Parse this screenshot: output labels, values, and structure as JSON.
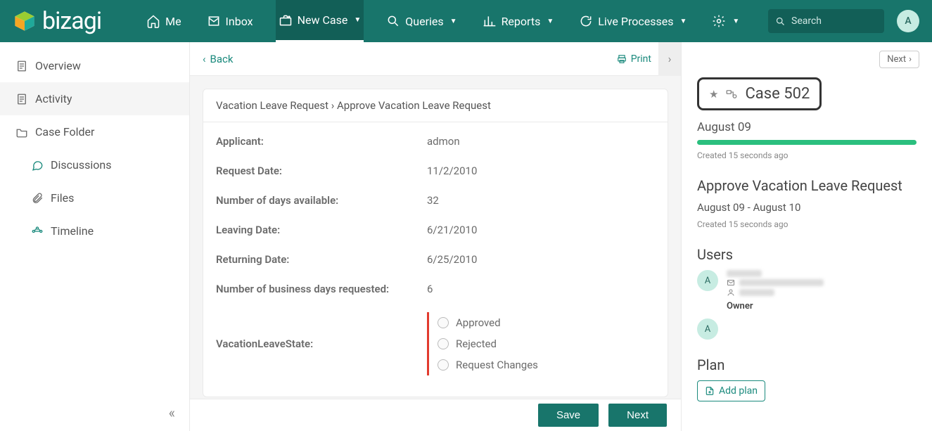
{
  "nav": {
    "brand": "bizagi",
    "items": [
      {
        "icon": "home",
        "label": "Me"
      },
      {
        "icon": "inbox",
        "label": "Inbox"
      },
      {
        "icon": "newcase",
        "label": "New Case",
        "dropdown": true,
        "active": true
      },
      {
        "icon": "search",
        "label": "Queries",
        "dropdown": true
      },
      {
        "icon": "chart",
        "label": "Reports",
        "dropdown": true
      },
      {
        "icon": "refresh",
        "label": "Live Processes",
        "dropdown": true
      },
      {
        "icon": "gear",
        "label": "",
        "dropdown": true
      }
    ],
    "search_placeholder": "Search",
    "avatar_initial": "A"
  },
  "sidebar": {
    "items": [
      {
        "icon": "doc",
        "label": "Overview"
      },
      {
        "icon": "doc",
        "label": "Activity",
        "active": true
      },
      {
        "icon": "folder",
        "label": "Case Folder"
      },
      {
        "icon": "chat",
        "label": "Discussions",
        "sub": true,
        "teal": true
      },
      {
        "icon": "clip",
        "label": "Files",
        "sub": true
      },
      {
        "icon": "timeline",
        "label": "Timeline",
        "sub": true,
        "teal": true
      }
    ]
  },
  "content": {
    "back": "Back",
    "print": "Print",
    "breadcrumb_a": "Vacation Leave Request",
    "breadcrumb_b": "Approve Vacation Leave Request",
    "fields": [
      {
        "label": "Applicant:",
        "value": "admon"
      },
      {
        "label": "Request Date:",
        "value": "11/2/2010"
      },
      {
        "label": "Number of days available:",
        "value": "32"
      },
      {
        "label": "Leaving Date:",
        "value": "6/21/2010"
      },
      {
        "label": "Returning Date:",
        "value": "6/25/2010"
      },
      {
        "label": "Number of business days requested:",
        "value": "6"
      }
    ],
    "state_label": "VacationLeaveState:",
    "state_options": [
      "Approved",
      "Rejected",
      "Request Changes"
    ],
    "save": "Save",
    "next": "Next"
  },
  "right": {
    "next_btn": "Next",
    "case_label": "Case 502",
    "date": "August 09",
    "created": "Created 15 seconds ago",
    "task_title": "Approve Vacation Leave Request",
    "task_range": "August 09 - August 10",
    "task_created": "Created 15 seconds ago",
    "users_h": "Users",
    "owner_label": "Owner",
    "user_initial": "A",
    "plan_h": "Plan",
    "add_plan": "Add plan"
  }
}
